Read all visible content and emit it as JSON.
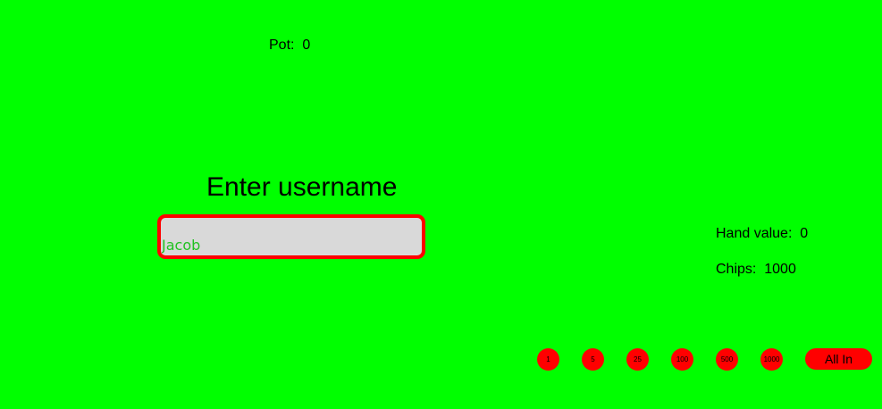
{
  "table": {
    "pot_label": "Pot:",
    "pot_value": "0"
  },
  "login": {
    "prompt": "Enter username",
    "username_value": "Jacob"
  },
  "player": {
    "hand_value_label": "Hand value:",
    "hand_value": "0",
    "chips_label": "Chips:",
    "chips_value": "1000"
  },
  "bets": {
    "chips": [
      "1",
      "5",
      "25",
      "100",
      "500",
      "1000"
    ],
    "all_in_label": "All In"
  },
  "colors": {
    "background": "#00ff00",
    "accent": "#ff0000",
    "input_bg": "#d9d9d9",
    "input_text": "#22c122"
  }
}
